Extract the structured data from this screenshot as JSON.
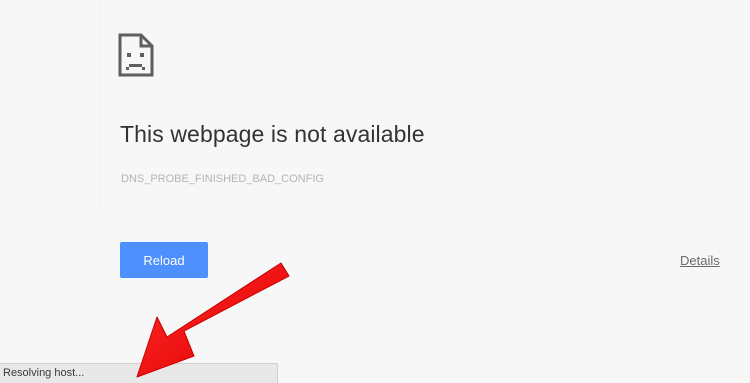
{
  "error_page": {
    "icon": "sad-page-icon",
    "title": "This webpage is not available",
    "error_code": "DNS_PROBE_FINISHED_BAD_CONFIG",
    "reload_label": "Reload",
    "details_label": "Details"
  },
  "status_bar": {
    "text": "Resolving host..."
  },
  "annotation": {
    "icon": "red-arrow-icon",
    "color": "#ff0000"
  },
  "colors": {
    "background": "#f7f7f7",
    "button": "#4d90fe",
    "title": "#333333",
    "error_code": "#b4b4b4"
  }
}
